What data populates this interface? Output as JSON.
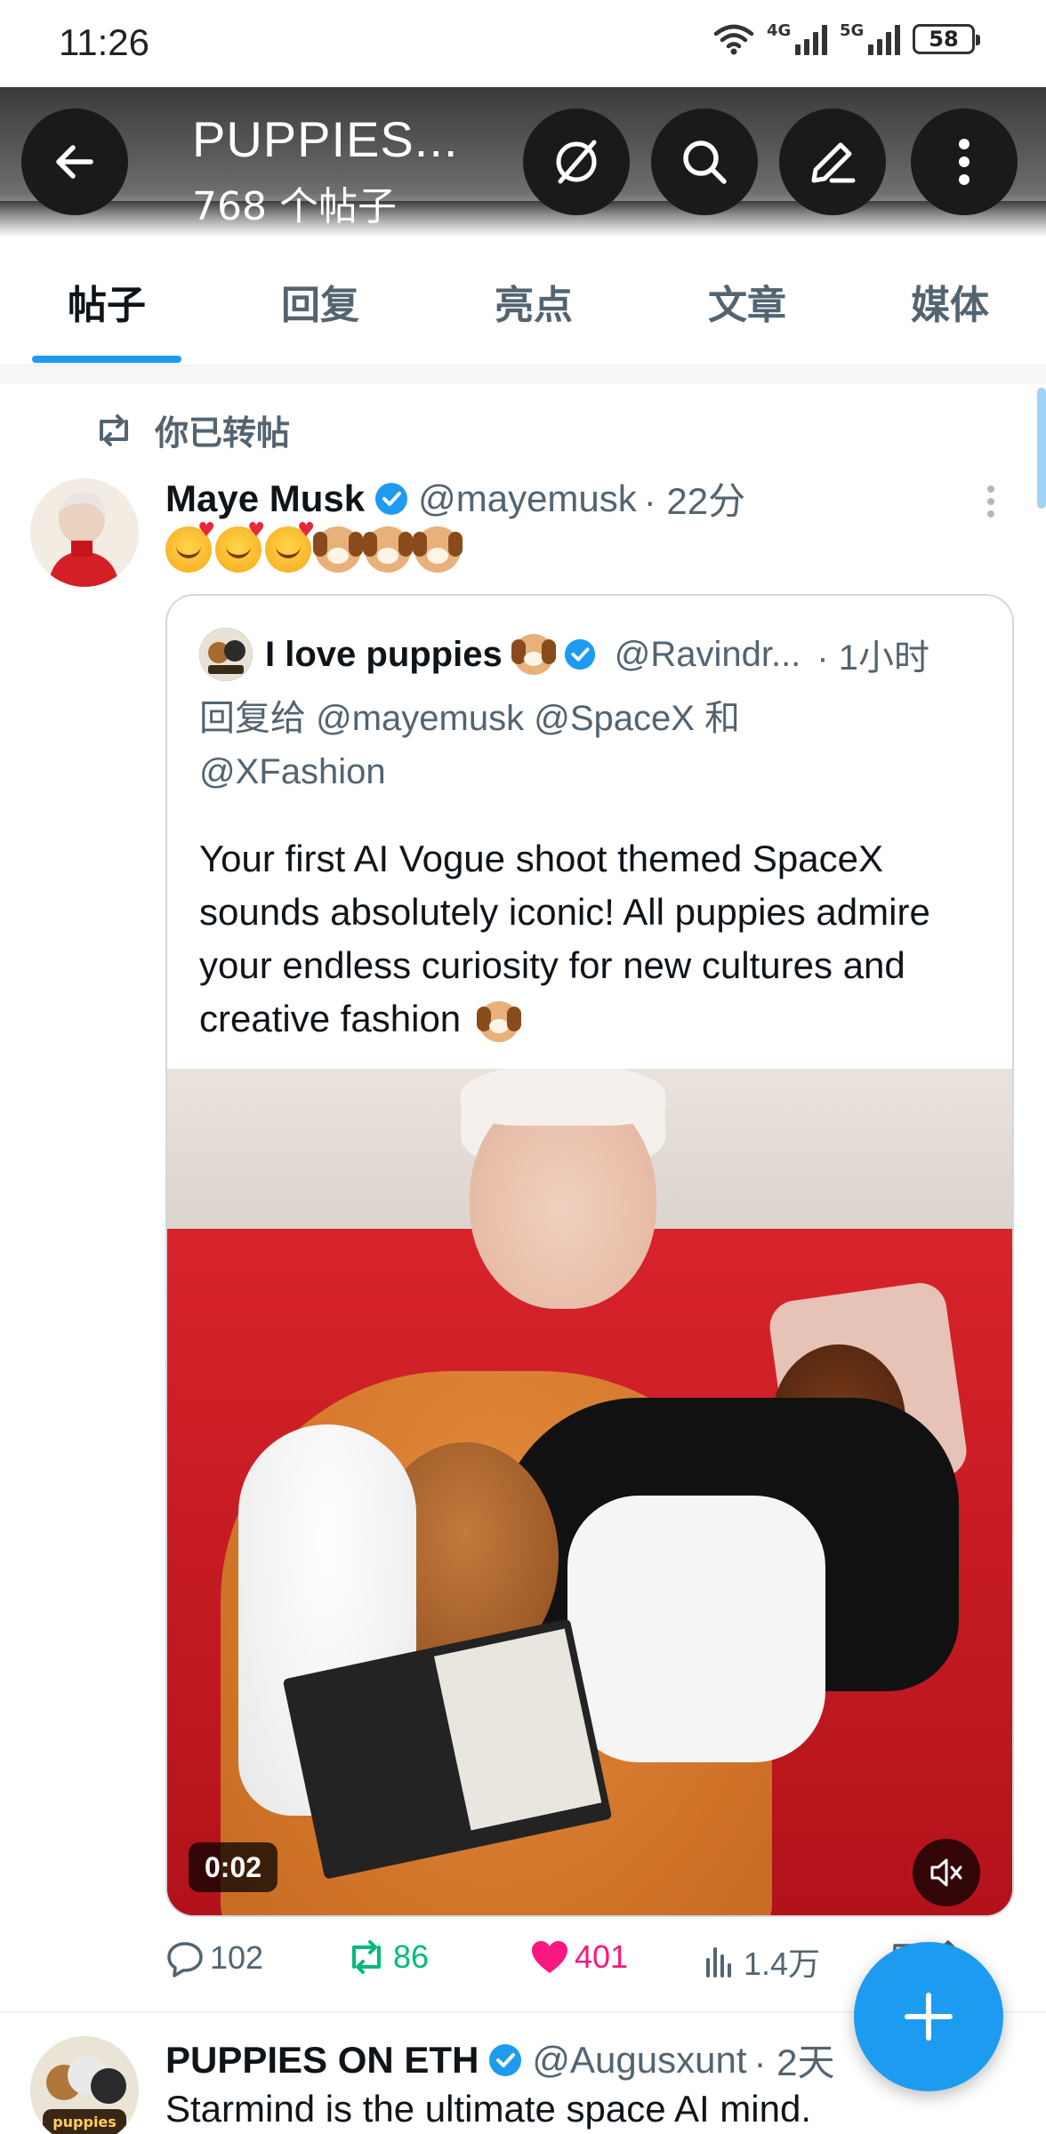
{
  "status_bar": {
    "time": "11:26",
    "network_1": "4G",
    "network_2": "5G",
    "battery": "58"
  },
  "header": {
    "title": "PUPPIES...",
    "subtitle": "768 个帖子",
    "banner_color": "#4a4a4a"
  },
  "tabs": [
    {
      "label": "帖子",
      "active": true
    },
    {
      "label": "回复",
      "active": false
    },
    {
      "label": "亮点",
      "active": false
    },
    {
      "label": "文章",
      "active": false
    },
    {
      "label": "媒体",
      "active": false
    }
  ],
  "tweet": {
    "repost_label": "你已转帖",
    "author_name": "Maye Musk",
    "author_handle": "@mayemusk",
    "time": "· 22分",
    "emojis": [
      "smiling-face-with-hearts",
      "smiling-face-with-hearts",
      "smiling-face-with-hearts",
      "dog-face",
      "dog-face",
      "dog-face"
    ],
    "quote": {
      "author_name": "I love puppies",
      "author_handle": "@Ravindr...",
      "time": "· 1小时",
      "reply_line_1": "回复给 @mayemusk @SpaceX 和",
      "reply_line_2": "@XFashion",
      "text": "Your first AI Vogue shoot themed SpaceX sounds absolutely iconic! All puppies admire your endless curiosity for new cultures and creative fashion",
      "video_time": "0:02"
    },
    "stats": {
      "replies": "102",
      "reposts": "86",
      "likes": "401",
      "views": "1.4万"
    }
  },
  "next_tweet": {
    "author_name": "PUPPIES ON ETH",
    "author_handle": "@Augusxunt",
    "time": "· 2天",
    "text": "Starmind is the ultimate space AI mind."
  },
  "colors": {
    "accent": "#1d9bf0",
    "repost": "#00ba7c",
    "like": "#f91880",
    "secondary_text": "#536471"
  }
}
